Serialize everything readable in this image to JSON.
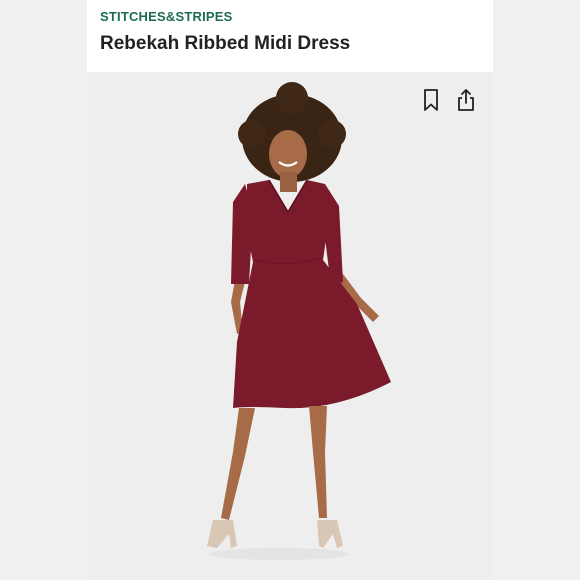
{
  "listing": {
    "brand": "STITCHES&STRIPES",
    "title": "Rebekah Ribbed Midi Dress"
  },
  "icons": {
    "bookmark": "bookmark-icon",
    "share": "share-icon"
  },
  "colors": {
    "brand": "#1d6b53",
    "dress": "#7b1a2b"
  }
}
